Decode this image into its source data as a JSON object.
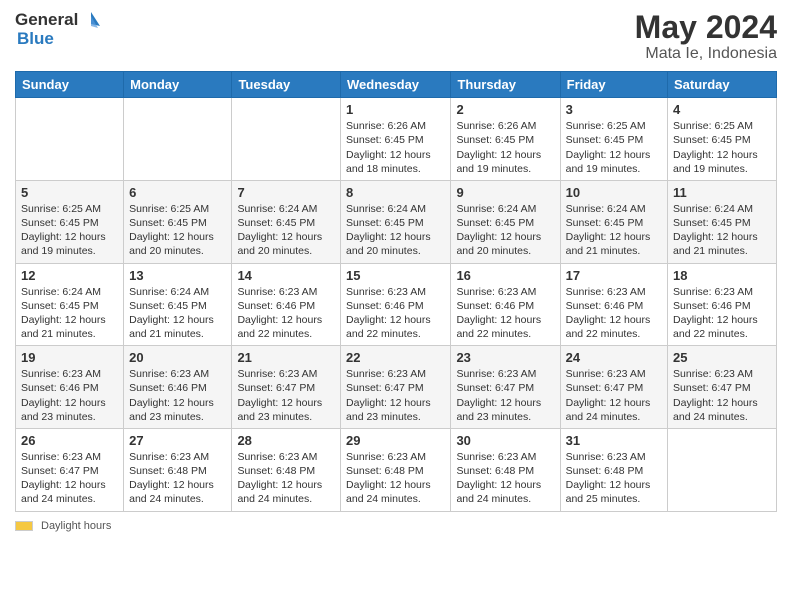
{
  "header": {
    "logo_line1": "General",
    "logo_line2": "Blue",
    "month_year": "May 2024",
    "location": "Mata Ie, Indonesia"
  },
  "days_of_week": [
    "Sunday",
    "Monday",
    "Tuesday",
    "Wednesday",
    "Thursday",
    "Friday",
    "Saturday"
  ],
  "footer": {
    "daylight_label": "Daylight hours"
  },
  "weeks": [
    [
      {
        "day": "",
        "info": ""
      },
      {
        "day": "",
        "info": ""
      },
      {
        "day": "",
        "info": ""
      },
      {
        "day": "1",
        "info": "Sunrise: 6:26 AM\nSunset: 6:45 PM\nDaylight: 12 hours\nand 18 minutes."
      },
      {
        "day": "2",
        "info": "Sunrise: 6:26 AM\nSunset: 6:45 PM\nDaylight: 12 hours\nand 19 minutes."
      },
      {
        "day": "3",
        "info": "Sunrise: 6:25 AM\nSunset: 6:45 PM\nDaylight: 12 hours\nand 19 minutes."
      },
      {
        "day": "4",
        "info": "Sunrise: 6:25 AM\nSunset: 6:45 PM\nDaylight: 12 hours\nand 19 minutes."
      }
    ],
    [
      {
        "day": "5",
        "info": "Sunrise: 6:25 AM\nSunset: 6:45 PM\nDaylight: 12 hours\nand 19 minutes."
      },
      {
        "day": "6",
        "info": "Sunrise: 6:25 AM\nSunset: 6:45 PM\nDaylight: 12 hours\nand 20 minutes."
      },
      {
        "day": "7",
        "info": "Sunrise: 6:24 AM\nSunset: 6:45 PM\nDaylight: 12 hours\nand 20 minutes."
      },
      {
        "day": "8",
        "info": "Sunrise: 6:24 AM\nSunset: 6:45 PM\nDaylight: 12 hours\nand 20 minutes."
      },
      {
        "day": "9",
        "info": "Sunrise: 6:24 AM\nSunset: 6:45 PM\nDaylight: 12 hours\nand 20 minutes."
      },
      {
        "day": "10",
        "info": "Sunrise: 6:24 AM\nSunset: 6:45 PM\nDaylight: 12 hours\nand 21 minutes."
      },
      {
        "day": "11",
        "info": "Sunrise: 6:24 AM\nSunset: 6:45 PM\nDaylight: 12 hours\nand 21 minutes."
      }
    ],
    [
      {
        "day": "12",
        "info": "Sunrise: 6:24 AM\nSunset: 6:45 PM\nDaylight: 12 hours\nand 21 minutes."
      },
      {
        "day": "13",
        "info": "Sunrise: 6:24 AM\nSunset: 6:45 PM\nDaylight: 12 hours\nand 21 minutes."
      },
      {
        "day": "14",
        "info": "Sunrise: 6:23 AM\nSunset: 6:46 PM\nDaylight: 12 hours\nand 22 minutes."
      },
      {
        "day": "15",
        "info": "Sunrise: 6:23 AM\nSunset: 6:46 PM\nDaylight: 12 hours\nand 22 minutes."
      },
      {
        "day": "16",
        "info": "Sunrise: 6:23 AM\nSunset: 6:46 PM\nDaylight: 12 hours\nand 22 minutes."
      },
      {
        "day": "17",
        "info": "Sunrise: 6:23 AM\nSunset: 6:46 PM\nDaylight: 12 hours\nand 22 minutes."
      },
      {
        "day": "18",
        "info": "Sunrise: 6:23 AM\nSunset: 6:46 PM\nDaylight: 12 hours\nand 22 minutes."
      }
    ],
    [
      {
        "day": "19",
        "info": "Sunrise: 6:23 AM\nSunset: 6:46 PM\nDaylight: 12 hours\nand 23 minutes."
      },
      {
        "day": "20",
        "info": "Sunrise: 6:23 AM\nSunset: 6:46 PM\nDaylight: 12 hours\nand 23 minutes."
      },
      {
        "day": "21",
        "info": "Sunrise: 6:23 AM\nSunset: 6:47 PM\nDaylight: 12 hours\nand 23 minutes."
      },
      {
        "day": "22",
        "info": "Sunrise: 6:23 AM\nSunset: 6:47 PM\nDaylight: 12 hours\nand 23 minutes."
      },
      {
        "day": "23",
        "info": "Sunrise: 6:23 AM\nSunset: 6:47 PM\nDaylight: 12 hours\nand 23 minutes."
      },
      {
        "day": "24",
        "info": "Sunrise: 6:23 AM\nSunset: 6:47 PM\nDaylight: 12 hours\nand 24 minutes."
      },
      {
        "day": "25",
        "info": "Sunrise: 6:23 AM\nSunset: 6:47 PM\nDaylight: 12 hours\nand 24 minutes."
      }
    ],
    [
      {
        "day": "26",
        "info": "Sunrise: 6:23 AM\nSunset: 6:47 PM\nDaylight: 12 hours\nand 24 minutes."
      },
      {
        "day": "27",
        "info": "Sunrise: 6:23 AM\nSunset: 6:48 PM\nDaylight: 12 hours\nand 24 minutes."
      },
      {
        "day": "28",
        "info": "Sunrise: 6:23 AM\nSunset: 6:48 PM\nDaylight: 12 hours\nand 24 minutes."
      },
      {
        "day": "29",
        "info": "Sunrise: 6:23 AM\nSunset: 6:48 PM\nDaylight: 12 hours\nand 24 minutes."
      },
      {
        "day": "30",
        "info": "Sunrise: 6:23 AM\nSunset: 6:48 PM\nDaylight: 12 hours\nand 24 minutes."
      },
      {
        "day": "31",
        "info": "Sunrise: 6:23 AM\nSunset: 6:48 PM\nDaylight: 12 hours\nand 25 minutes."
      },
      {
        "day": "",
        "info": ""
      }
    ]
  ]
}
